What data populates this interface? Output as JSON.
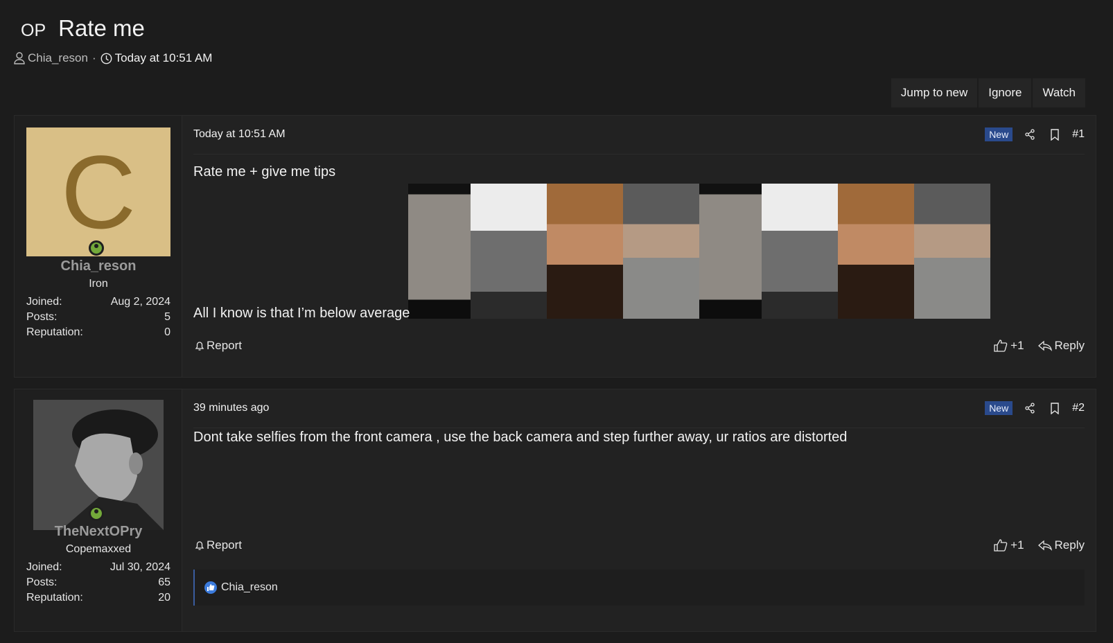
{
  "thread": {
    "prefix": "OP",
    "title": "Rate me",
    "author": "Chia_reson",
    "date": "Today at 10:51 AM"
  },
  "actions": {
    "jump": "Jump to new",
    "ignore": "Ignore",
    "watch": "Watch"
  },
  "posts": [
    {
      "user": {
        "avatar_letter": "C",
        "name": "Chia_reson",
        "title": "Iron",
        "joined_label": "Joined:",
        "joined": "Aug 2, 2024",
        "posts_label": "Posts:",
        "posts": "5",
        "rep_label": "Reputation:",
        "rep": "0"
      },
      "date": "Today at 10:51 AM",
      "badge": "New",
      "number": "#1",
      "line1": "Rate me + give me tips",
      "line2": "All I know is that I’m below average",
      "report": "Report",
      "likes": "+1",
      "reply": "Reply"
    },
    {
      "user": {
        "name": "TheNextOPry",
        "title": "Copemaxxed",
        "joined_label": "Joined:",
        "joined": "Jul 30, 2024",
        "posts_label": "Posts:",
        "posts": "65",
        "rep_label": "Reputation:",
        "rep": "20"
      },
      "date": "39 minutes ago",
      "badge": "New",
      "number": "#2",
      "text": "Dont take selfies from the front camera , use the back camera and step further away, ur ratios are distorted",
      "report": "Report",
      "likes": "+1",
      "reply": "Reply",
      "liked_by": "Chia_reson"
    }
  ],
  "colors": {
    "background": "#1c1c1c",
    "badge": "#2a4a8c",
    "online": "#73a93a",
    "avatar_bg": "#d9bf86"
  }
}
